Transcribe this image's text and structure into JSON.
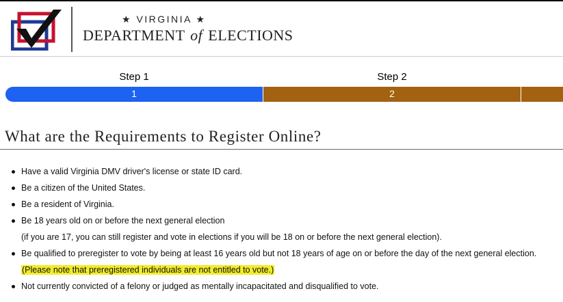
{
  "header": {
    "state_label": "★ VIRGINIA ★",
    "agency_part1": "DEPARTMENT",
    "agency_of": "of",
    "agency_part2": "ELECTIONS"
  },
  "steps": [
    {
      "label": "Step 1",
      "number": "1",
      "status": "active",
      "color": "#1d62f0"
    },
    {
      "label": "Step 2",
      "number": "2",
      "status": "inactive",
      "color": "#a36210"
    }
  ],
  "section": {
    "title": "What are the Requirements to Register Online?"
  },
  "requirements": [
    {
      "text": "Have a valid Virginia DMV driver's license or state ID card."
    },
    {
      "text": "Be a citizen of the United States."
    },
    {
      "text": "Be a resident of Virginia."
    },
    {
      "text": "Be 18 years old on or before the next general election",
      "note": "(if you are 17, you can still register and vote in elections if you will be 18 on or before the next general election)."
    },
    {
      "text": "Be qualified to preregister to vote by being at least 16 years old but not 18 years of age on or before the day of the next general election.",
      "note": "(Please note that preregistered individuals are not entitled to vote.)"
    },
    {
      "text": "Not currently convicted of a felony or judged as mentally incapacitated and disqualified to vote."
    }
  ],
  "colors": {
    "step_active": "#1d62f0",
    "step_inactive": "#a36210",
    "highlight": "#f2ec2a",
    "logo_red": "#c8102e",
    "logo_blue": "#1f3a93"
  }
}
